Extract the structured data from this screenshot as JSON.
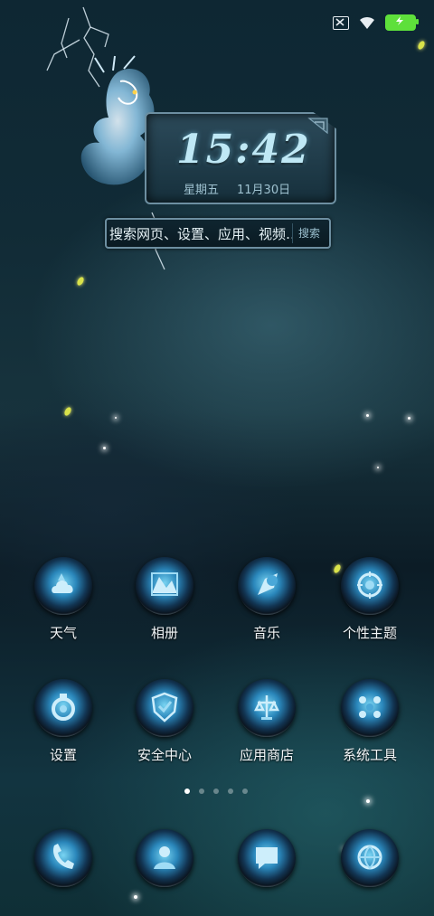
{
  "status_bar": {
    "icons": [
      "notification-x-icon",
      "wifi-icon",
      "battery-charging-icon"
    ],
    "battery_color": "#5ee03b"
  },
  "clock": {
    "time": "15:42",
    "weekday": "星期五",
    "date": "11月30日"
  },
  "search": {
    "placeholder": "搜索网页、设置、应用、视频…",
    "button_label": "搜索"
  },
  "apps_row1": [
    {
      "label": "天气",
      "icon": "weather-icon"
    },
    {
      "label": "相册",
      "icon": "gallery-icon"
    },
    {
      "label": "音乐",
      "icon": "music-icon"
    },
    {
      "label": "个性主题",
      "icon": "theme-icon"
    }
  ],
  "apps_row2": [
    {
      "label": "设置",
      "icon": "settings-icon"
    },
    {
      "label": "安全中心",
      "icon": "security-icon"
    },
    {
      "label": "应用商店",
      "icon": "app-store-icon"
    },
    {
      "label": "系统工具",
      "icon": "system-tools-icon"
    }
  ],
  "dock": [
    {
      "icon": "phone-icon"
    },
    {
      "icon": "contacts-icon"
    },
    {
      "icon": "messages-icon"
    },
    {
      "icon": "browser-icon"
    }
  ],
  "pager": {
    "count": 5,
    "active_index": 0
  },
  "colors": {
    "accent": "#2a87bb",
    "glow": "#79d4f2"
  }
}
